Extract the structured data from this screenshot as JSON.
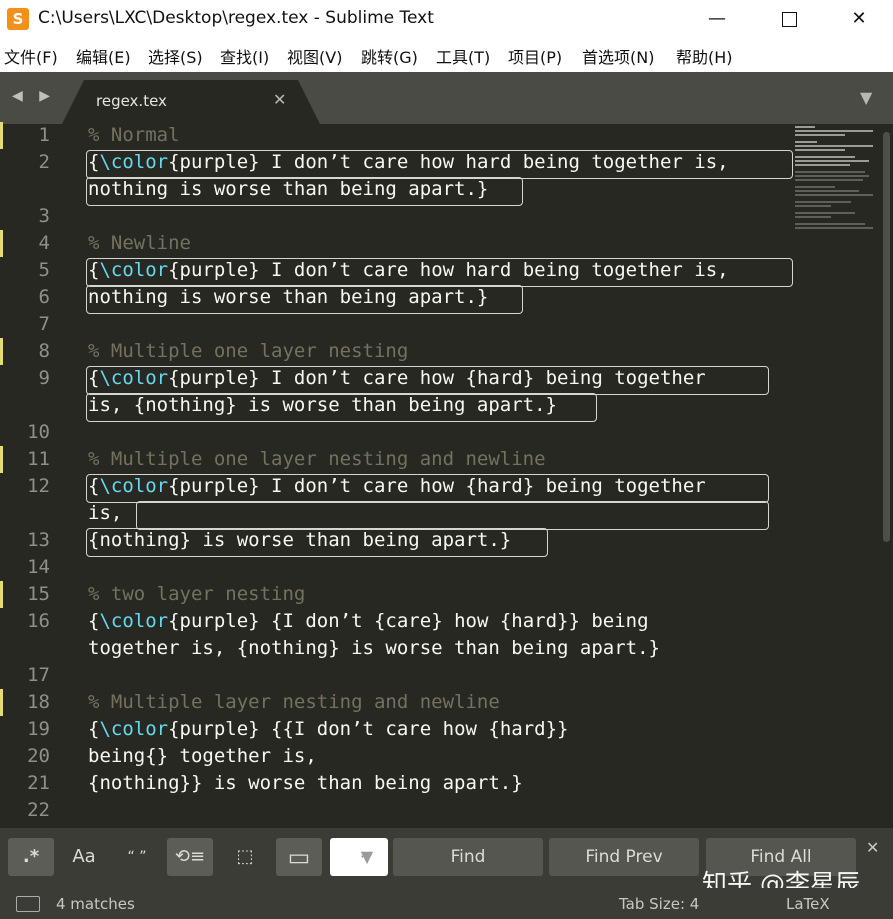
{
  "window": {
    "title": "C:\\Users\\LXC\\Desktop\\regex.tex - Sublime Text",
    "app_icon_glyph": "S",
    "minimize_glyph": "—",
    "close_glyph": "✕"
  },
  "menu": [
    "文件(F)",
    "编辑(E)",
    "选择(S)",
    "查找(I)",
    "视图(V)",
    "跳转(G)",
    "工具(T)",
    "项目(P)",
    "首选项(N)",
    "帮助(H)"
  ],
  "tabs": {
    "nav_arrows": "◀ ▶",
    "active_label": "regex.tex",
    "close_glyph": "✕",
    "dropdown_glyph": "▼"
  },
  "editor": {
    "lines": [
      {
        "n": "1",
        "segs": [
          [
            "cm",
            "% Normal"
          ]
        ]
      },
      {
        "n": "2",
        "segs": [
          [
            "",
            "{"
          ],
          [
            "kw",
            "\\color"
          ],
          [
            "",
            "{purple} I don’t care how hard being together is,"
          ]
        ]
      },
      {
        "n": "",
        "segs": [
          [
            "",
            "nothing is worse than being apart.}"
          ]
        ]
      },
      {
        "n": "3",
        "segs": []
      },
      {
        "n": "4",
        "segs": [
          [
            "cm",
            "% Newline"
          ]
        ]
      },
      {
        "n": "5",
        "segs": [
          [
            "",
            "{"
          ],
          [
            "kw",
            "\\color"
          ],
          [
            "",
            "{purple} I don’t care how hard being together is,"
          ]
        ]
      },
      {
        "n": "6",
        "segs": [
          [
            "",
            "nothing is worse than being apart.}"
          ]
        ]
      },
      {
        "n": "7",
        "segs": []
      },
      {
        "n": "8",
        "segs": [
          [
            "cm",
            "% Multiple one layer nesting"
          ]
        ]
      },
      {
        "n": "9",
        "segs": [
          [
            "",
            "{"
          ],
          [
            "kw",
            "\\color"
          ],
          [
            "",
            "{purple} I don’t care how {hard} being together"
          ]
        ]
      },
      {
        "n": "",
        "segs": [
          [
            "",
            "is, {nothing} is worse than being apart.}"
          ]
        ]
      },
      {
        "n": "10",
        "segs": []
      },
      {
        "n": "11",
        "segs": [
          [
            "cm",
            "% Multiple one layer nesting and newline"
          ]
        ]
      },
      {
        "n": "12",
        "segs": [
          [
            "",
            "{"
          ],
          [
            "kw",
            "\\color"
          ],
          [
            "",
            "{purple} I don’t care how {hard} being together"
          ]
        ]
      },
      {
        "n": "",
        "segs": [
          [
            "",
            "is,"
          ]
        ]
      },
      {
        "n": "13",
        "segs": [
          [
            "",
            "{nothing} is worse than being apart.}"
          ]
        ]
      },
      {
        "n": "14",
        "segs": []
      },
      {
        "n": "15",
        "segs": [
          [
            "cm",
            "% two layer nesting"
          ]
        ]
      },
      {
        "n": "16",
        "segs": [
          [
            "",
            "{"
          ],
          [
            "kw",
            "\\color"
          ],
          [
            "",
            "{purple} {I don’t {care} how {hard}} being"
          ]
        ]
      },
      {
        "n": "",
        "segs": [
          [
            "",
            "together is, {nothing} is worse than being apart.}"
          ]
        ]
      },
      {
        "n": "17",
        "segs": []
      },
      {
        "n": "18",
        "segs": [
          [
            "cm",
            "% Multiple layer nesting and newline"
          ]
        ]
      },
      {
        "n": "19",
        "segs": [
          [
            "",
            "{"
          ],
          [
            "kw",
            "\\color"
          ],
          [
            "",
            "{purple} {{I don’t care how {hard}}"
          ]
        ]
      },
      {
        "n": "20",
        "segs": [
          [
            "",
            "being{} together is,"
          ]
        ]
      },
      {
        "n": "21",
        "segs": [
          [
            "",
            "{nothing}} is worse than being apart.}"
          ]
        ]
      },
      {
        "n": "22",
        "segs": []
      }
    ],
    "marked_line_numbers": [
      "1",
      "4",
      "8",
      "11",
      "15",
      "18"
    ]
  },
  "find_panel": {
    "regex_label": ".*",
    "case_label": "Aa",
    "whole_word_label": "“ ”",
    "wrap_label": "⟲≡",
    "in_selection_label": "⬚",
    "highlight_label": "▭",
    "input_value": "·",
    "input_dropdown": "▼",
    "find_label": "Find",
    "find_prev_label": "Find Prev",
    "find_all_label": "Find All",
    "close_glyph": "✕",
    "watermark": "知乎 @李星辰"
  },
  "status_bar": {
    "matches": "4 matches",
    "tab_size": "Tab Size: 4",
    "syntax": "LaTeX"
  }
}
